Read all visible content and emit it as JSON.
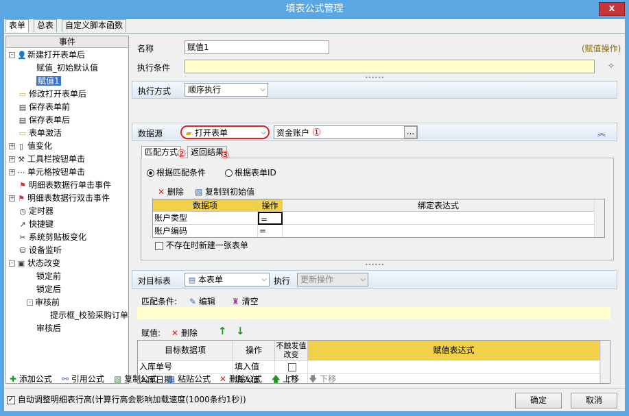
{
  "window": {
    "title": "填表公式管理",
    "close": "x"
  },
  "tabs": [
    "表单",
    "总表",
    "自定义脚本函数"
  ],
  "left": {
    "header": "事件",
    "tree": [
      {
        "label": "新建打开表单后",
        "expander": "⊟"
      },
      {
        "label": "赋值_初始默认值"
      },
      {
        "label": "赋值1"
      },
      {
        "label": "修改打开表单后"
      },
      {
        "label": "保存表单前"
      },
      {
        "label": "保存表单后"
      },
      {
        "label": "表单激活"
      },
      {
        "label": "值变化",
        "expander": "⊞"
      },
      {
        "label": "工具栏按钮单击",
        "expander": "⊞"
      },
      {
        "label": "单元格按钮单击",
        "expander": "⊞"
      },
      {
        "label": "明细表数据行单击事件"
      },
      {
        "label": "明细表数据行双击事件",
        "expander": "⊞"
      },
      {
        "label": "定时器"
      },
      {
        "label": "快捷键"
      },
      {
        "label": "系统剪贴板变化"
      },
      {
        "label": "设备监听"
      },
      {
        "label": "状态改变",
        "expander": "⊟"
      },
      {
        "label": "锁定前"
      },
      {
        "label": "锁定后"
      },
      {
        "label": "审核前",
        "expander": "⊟"
      },
      {
        "label": "提示框_校验采购订单"
      },
      {
        "label": "审核后"
      }
    ]
  },
  "form": {
    "name_label": "名称",
    "name_value": "赋值1",
    "type_hint": "(赋值操作)",
    "cond_label": "执行条件",
    "cond_value": "",
    "mode_label": "执行方式",
    "mode_value": "顺序执行"
  },
  "datasource": {
    "label": "数据源",
    "action": "打开表单",
    "table": "资金账户",
    "browse": "...",
    "mark1": "①",
    "mark2": "②",
    "mark3": "③",
    "collapse": "︽",
    "inner_tabs": [
      "匹配方式",
      "返回结果"
    ],
    "radio1": "根据匹配条件",
    "radio2": "根据表单ID",
    "delete": "删除",
    "copy_init": "复制到初始值",
    "columns": [
      "数据项",
      "操作",
      "绑定表达式"
    ],
    "rows": [
      {
        "item": "账户类型",
        "op": "=",
        "expr": ""
      },
      {
        "item": "账户编码",
        "op": "=",
        "expr": ""
      }
    ],
    "new_if_missing": "不存在时新建一张表单"
  },
  "target": {
    "label": "对目标表",
    "table": "本表单",
    "exec_label": "执行",
    "exec_value": "更新操作",
    "match_label": "匹配条件:",
    "edit": "编辑",
    "clear": "清空",
    "assign_label": "赋值:",
    "delete": "删除",
    "up": "↑",
    "down": "↓",
    "columns": [
      "目标数据项",
      "操作",
      "不触发值改变",
      "赋值表达式"
    ],
    "rows": [
      {
        "item": "入库单号",
        "op": "填入值",
        "expr": ""
      },
      {
        "item": "入库日期",
        "op": "填入值",
        "expr": ""
      }
    ]
  },
  "toolbar": {
    "add": "添加公式",
    "ref": "引用公式",
    "copy": "复制公式",
    "paste": "粘贴公式",
    "del": "删除公式",
    "up": "上移",
    "down": "下移"
  },
  "footer": {
    "auto_height": "自动调整明细表行高(计算行高会影响加载速度(1000条约1秒))",
    "ok": "确定",
    "cancel": "取消"
  }
}
